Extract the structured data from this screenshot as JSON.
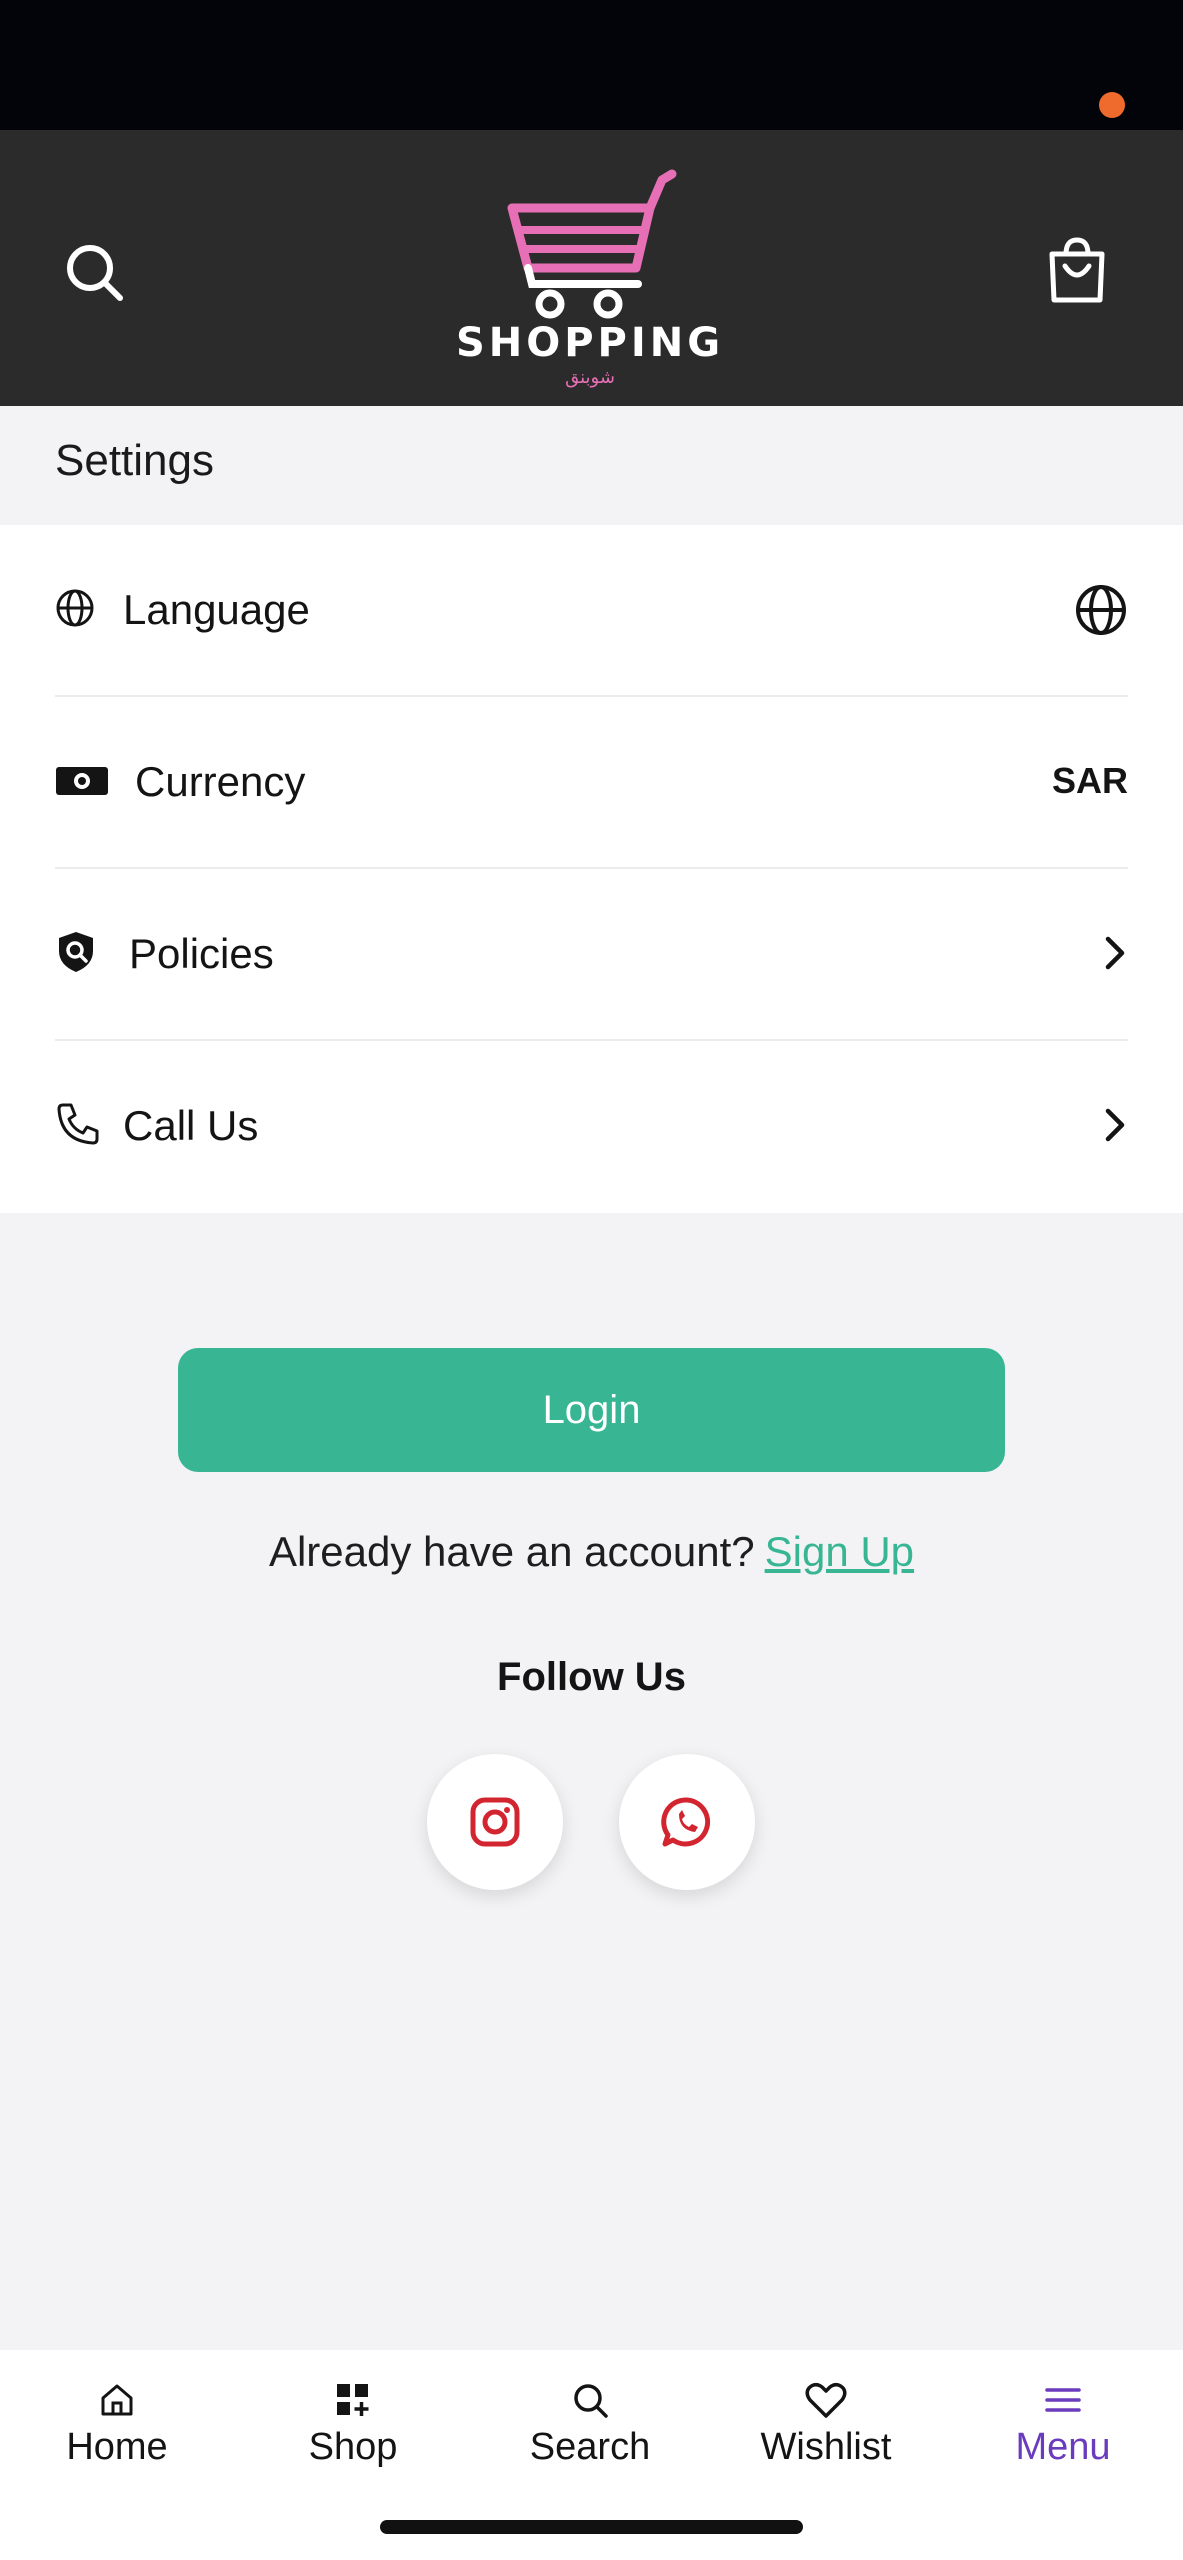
{
  "header": {
    "logo_text": "SHOPPING",
    "logo_arabic": "شوبنق",
    "cart_has_notification": true
  },
  "settings": {
    "title": "Settings",
    "rows": [
      {
        "label": "Language",
        "trailing": "globe-icon"
      },
      {
        "label": "Currency",
        "trailing_text": "SAR"
      },
      {
        "label": "Policies",
        "trailing": "chevron-right-icon"
      },
      {
        "label": "Call Us",
        "trailing": "chevron-right-icon"
      }
    ]
  },
  "auth": {
    "login_label": "Login",
    "prompt": "Already have an account?",
    "signup_label": "Sign Up"
  },
  "follow": {
    "title": "Follow Us",
    "links": [
      "instagram-icon",
      "whatsapp-icon"
    ]
  },
  "tabbar": {
    "active": "Menu",
    "items": [
      {
        "label": "Home",
        "icon": "home-icon"
      },
      {
        "label": "Shop",
        "icon": "shop-grid-icon"
      },
      {
        "label": "Search",
        "icon": "search-icon"
      },
      {
        "label": "Wishlist",
        "icon": "heart-icon"
      },
      {
        "label": "Menu",
        "icon": "menu-icon"
      }
    ]
  },
  "colors": {
    "header_bg": "#2b2b2b",
    "accent_green": "#38b694",
    "logo_pink": "#e76fb5",
    "active_tab": "#6a3bbd",
    "social_red": "#d3252f",
    "cart_dot": "#ef6a2d"
  }
}
